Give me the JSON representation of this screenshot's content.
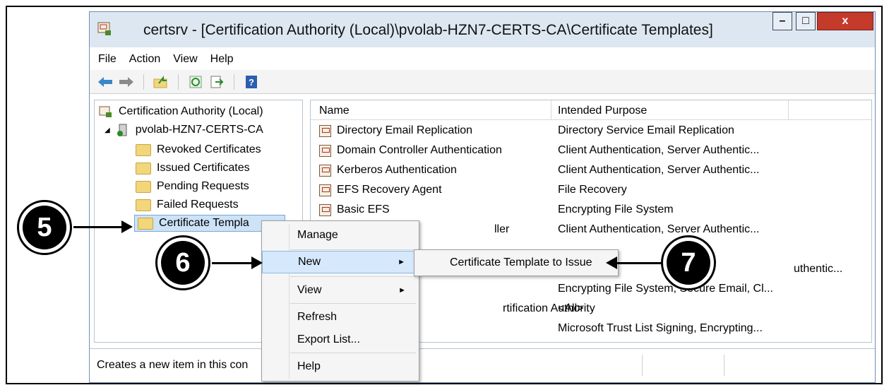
{
  "window": {
    "title": "certsrv - [Certification Authority (Local)\\pvolab-HZN7-CERTS-CA\\Certificate Templates]",
    "controls": {
      "minimize": "–",
      "maximize": "□",
      "close": "x"
    }
  },
  "menubar": [
    "File",
    "Action",
    "View",
    "Help"
  ],
  "toolbar": [
    "back-arrow-icon",
    "forward-arrow-icon",
    "up-folder-icon",
    "refresh-icon",
    "export-icon",
    "help-icon"
  ],
  "tree": {
    "root": "Certification Authority (Local)",
    "ca": "pvolab-HZN7-CERTS-CA",
    "expander": "◢",
    "children": [
      "Revoked Certificates",
      "Issued Certificates",
      "Pending Requests",
      "Failed Requests",
      "Certificate Templa"
    ]
  },
  "list": {
    "columns": [
      "Name",
      "Intended Purpose"
    ],
    "rows": [
      {
        "name": "Directory Email Replication",
        "purpose": "Directory Service Email Replication"
      },
      {
        "name": "Domain Controller Authentication",
        "purpose": "Client Authentication, Server Authentic..."
      },
      {
        "name": "Kerberos Authentication",
        "purpose": "Client Authentication, Server Authentic..."
      },
      {
        "name": "EFS Recovery Agent",
        "purpose": "File Recovery"
      },
      {
        "name": "Basic EFS",
        "purpose": "Encrypting File System"
      },
      {
        "name": "ller",
        "purpose": "Client Authentication, Server Authentic..."
      },
      {
        "name": "",
        "purpose": ""
      },
      {
        "name": "",
        "purpose": "uthentic..."
      },
      {
        "name": "",
        "purpose": "Encrypting File System, Secure Email, Cl..."
      },
      {
        "name": "rtification Authority",
        "purpose": "<All>"
      },
      {
        "name": "",
        "purpose": "Microsoft Trust List Signing, Encrypting..."
      }
    ]
  },
  "status": "Creates a new item in this con",
  "context_menu": {
    "items": [
      "Manage",
      "New",
      "View",
      "Refresh",
      "Export List...",
      "Help"
    ],
    "submenu_arrow": "►",
    "submenu": [
      "Certificate Template to Issue"
    ]
  },
  "callouts": [
    "5",
    "6",
    "7"
  ]
}
